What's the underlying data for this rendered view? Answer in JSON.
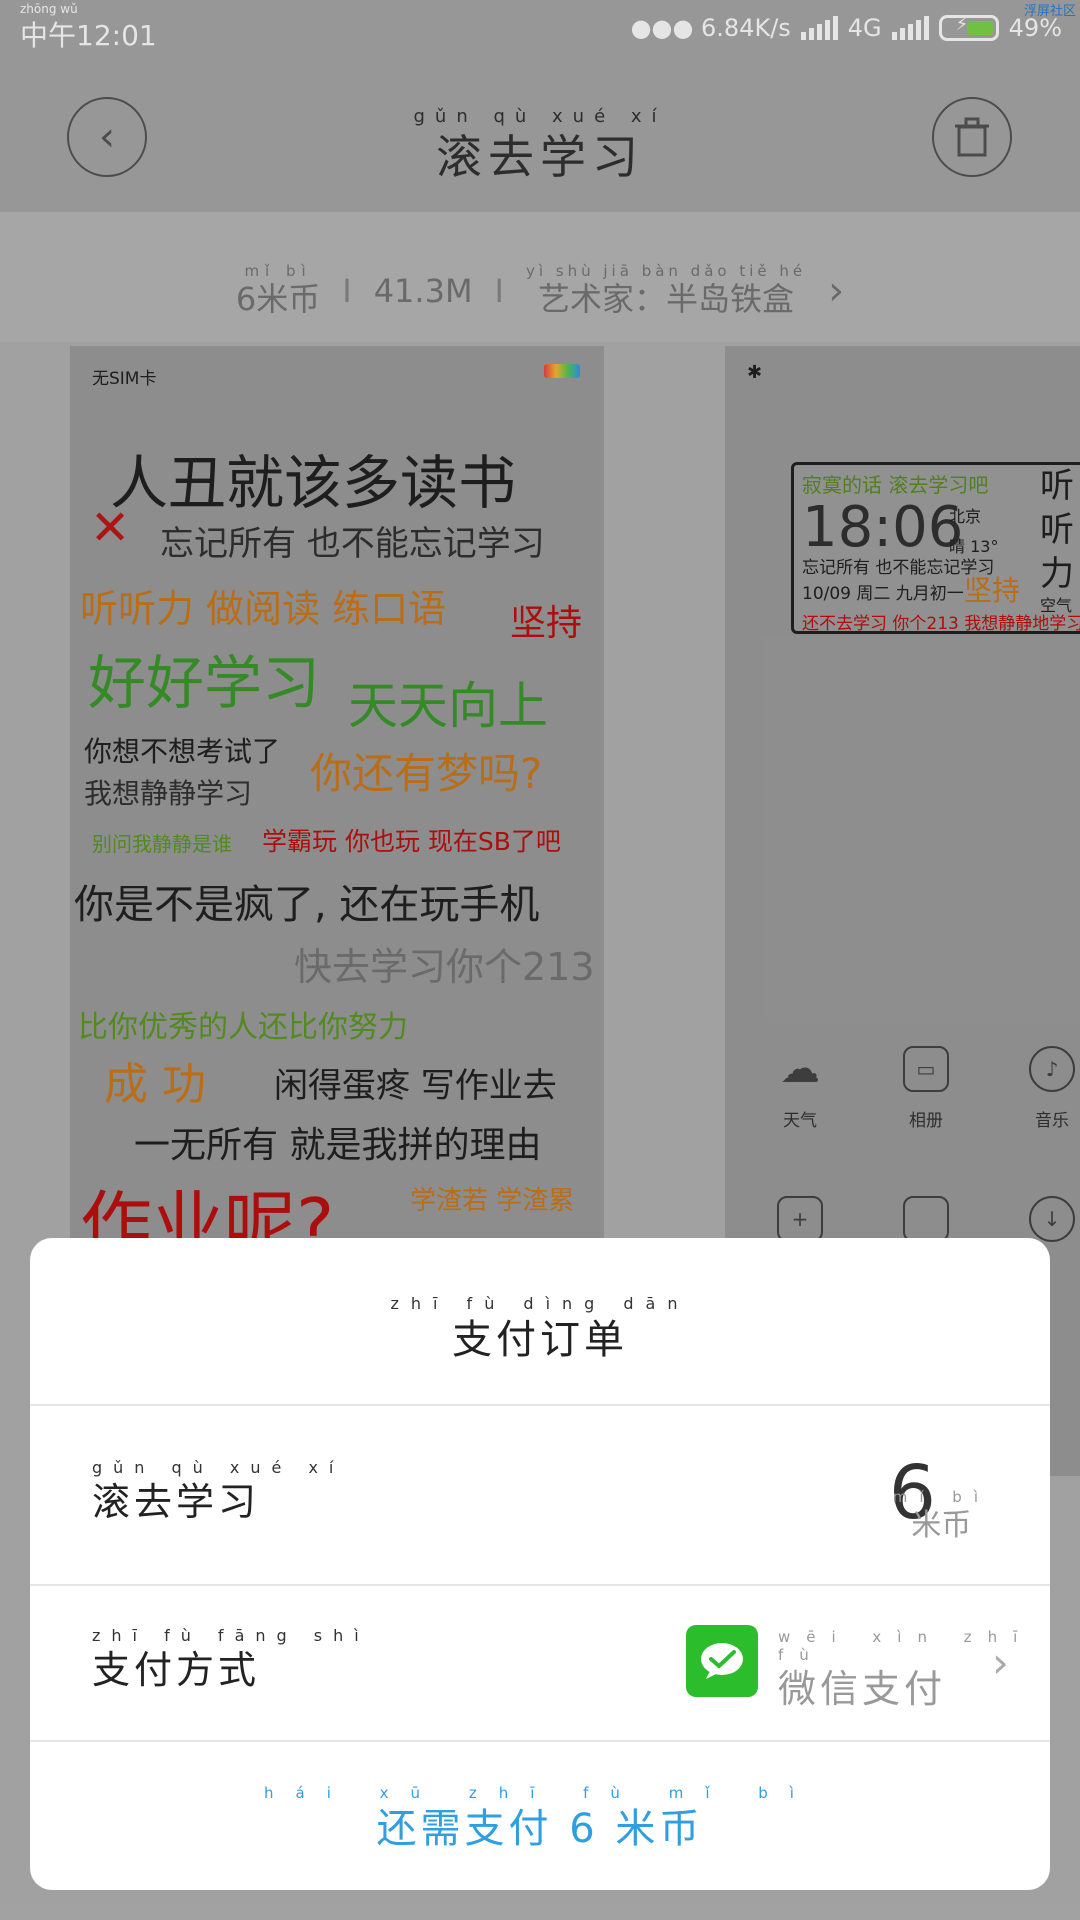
{
  "status_bar": {
    "time_pinyin": "zhōng wǔ",
    "time": "中午12:01",
    "network_speed": "●●● 6.84K/s",
    "network_type": "4G",
    "battery": "49%",
    "corner_tag": "浮屏社区"
  },
  "header": {
    "title_pinyin": "gǔn qù xué xí",
    "title": "滚去学习"
  },
  "info": {
    "price": "6米币",
    "price_pinyin": "mǐ bì",
    "size": "41.3M",
    "artist_pinyin": "yì shù jiā   bàn dǎo tiě hé",
    "artist": "艺术家：半岛铁盒",
    "separator": "I"
  },
  "preview_left": {
    "status_left": "无SIM卡",
    "lines": [
      {
        "text": "人丑就该多读书",
        "color": "#222222"
      },
      {
        "text": "✕",
        "color": "#c01818"
      },
      {
        "text": "忘记所有 也不能忘记学习",
        "color": "#333333"
      },
      {
        "text": "听听力 做阅读 练口语",
        "color": "#d07a1a"
      },
      {
        "text": "坚持",
        "color": "#c01010"
      },
      {
        "text": "好好学习",
        "color": "#3a9a2a"
      },
      {
        "text": "天天向上",
        "color": "#3a9a2a"
      },
      {
        "text": "你想不想考试了",
        "color": "#222222"
      },
      {
        "text": "你还有梦吗?",
        "color": "#d07a1a"
      },
      {
        "text": "我想静静学习",
        "color": "#333333"
      },
      {
        "text": "别问我静静是谁",
        "color": "#5b9a22"
      },
      {
        "text": "学霸玩 你也玩 现在SB了吧",
        "color": "#c01010"
      },
      {
        "text": "你是不是疯了, 还在玩手机",
        "color": "#222222"
      },
      {
        "text": "快去学习你个213",
        "color": "#777777"
      },
      {
        "text": "比你优秀的人还比你努力",
        "color": "#5b9a22"
      },
      {
        "text": "成 功",
        "color": "#d07a1a"
      },
      {
        "text": "闲得蛋疼 写作业去",
        "color": "#222222"
      },
      {
        "text": "一无所有 就是我拼的理由",
        "color": "#222222"
      },
      {
        "text": "作业呢?",
        "color": "#c01010"
      },
      {
        "text": "学渣若 学渣累",
        "color": "#d07a1a"
      }
    ]
  },
  "preview_right": {
    "widget": {
      "line1": "寂寞的话 滚去学习吧",
      "time": "18:06",
      "city": "北京",
      "temp": "晴 13°",
      "line3": "忘记所有 也不能忘记学习",
      "line4": "10/09 周二 九月初一",
      "keep": "坚持",
      "line5": "还不去学习 你个213 我想静静地学习"
    },
    "side_text": [
      "听",
      "听",
      "力",
      "空气"
    ],
    "apps": [
      {
        "label": "天气",
        "icon": "☁"
      },
      {
        "label": "相册",
        "icon": "▭"
      },
      {
        "label": "音乐",
        "icon": "♪"
      }
    ]
  },
  "sheet": {
    "title_pinyin": "zhī fù dìng dān",
    "title": "支付订单",
    "item_pinyin": "gǔn qù xué xí",
    "item": "滚去学习",
    "amount": "6",
    "unit_pinyin": "mǐ bì",
    "unit": "米币",
    "method_pinyin": "zhī fù fāng shì",
    "method_label": "支付方式",
    "method_value_pinyin": "wēi xìn zhī fù",
    "method_value": "微信支付",
    "pay_button_pinyin": "hái xū zhī fù    mǐ bì",
    "pay_button": "还需支付 6 米币"
  }
}
